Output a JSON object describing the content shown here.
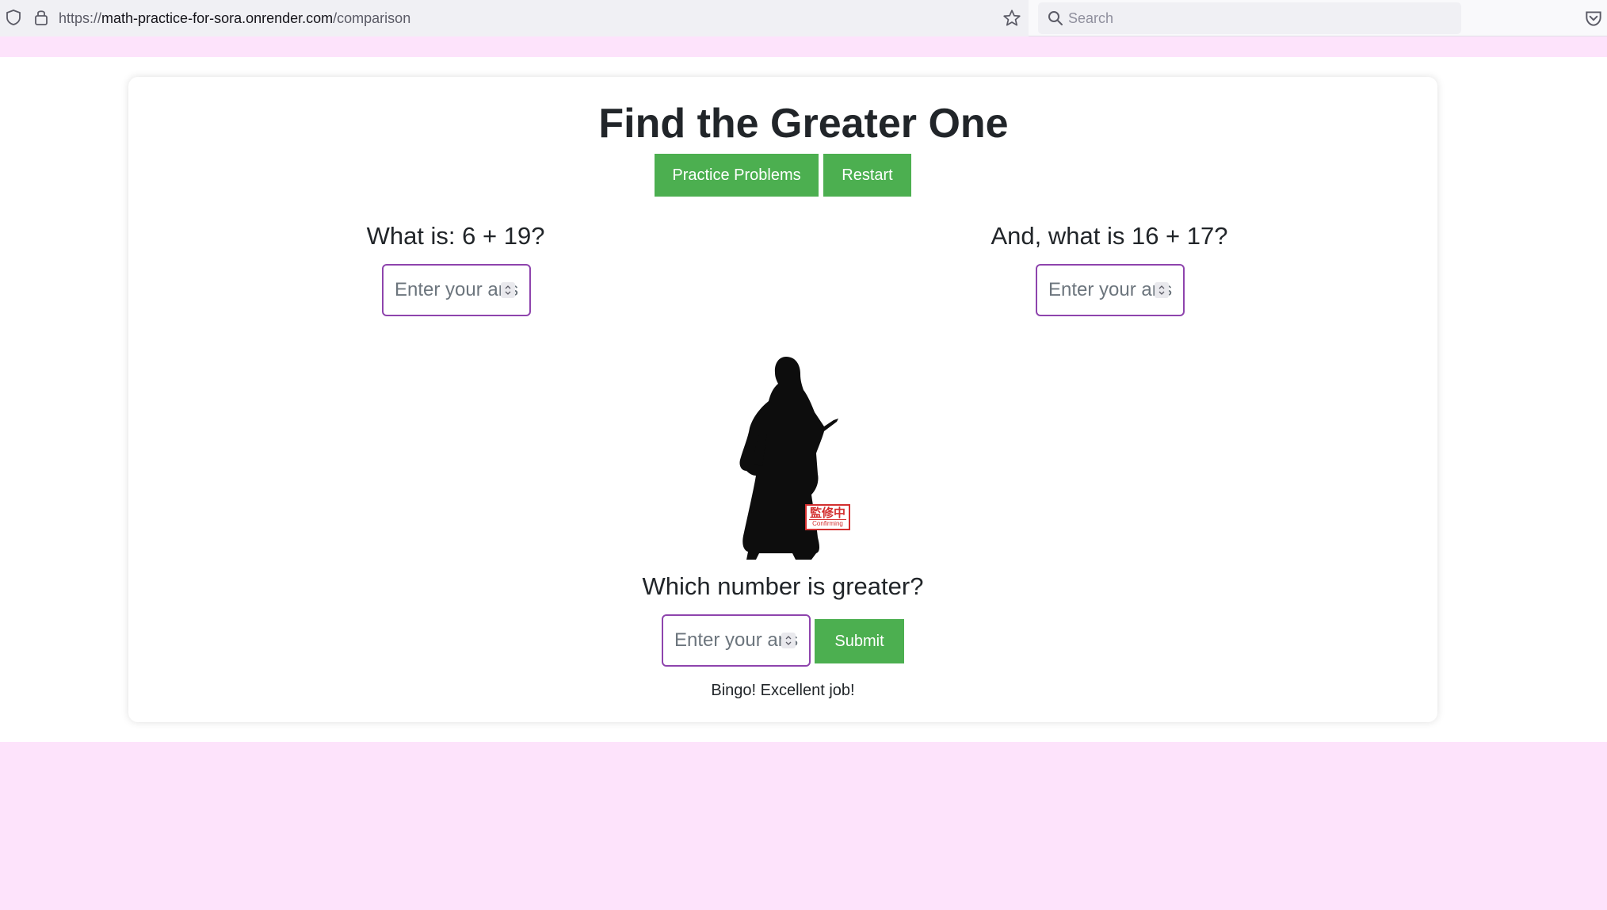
{
  "browser": {
    "url_prefix": "https://",
    "url_host": "math-practice-for-sora.onrender.com",
    "url_path": "/comparison",
    "search_placeholder": "Search"
  },
  "page": {
    "title": "Find the Greater One",
    "practice_button": "Practice Problems",
    "restart_button": "Restart",
    "question_1": "What is: 6 + 19?",
    "question_2": "And, what is 16 + 17?",
    "input_placeholder": "Enter your answer",
    "comparison_question": "Which number is greater?",
    "submit_button": "Submit",
    "feedback": "Bingo! Excellent job!",
    "image": {
      "stamp_text": "監修中",
      "stamp_subtext": "Confirming"
    }
  },
  "colors": {
    "page_background": "#fde3fb",
    "button_green": "#4caf50",
    "input_border": "#8e44ad",
    "stamp_red": "#d32f2f"
  }
}
